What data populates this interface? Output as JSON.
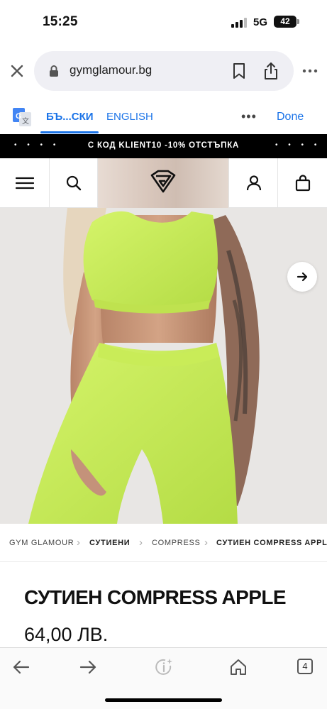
{
  "status_bar": {
    "time": "15:25",
    "network": "5G",
    "battery": "42"
  },
  "browser": {
    "url": "gymglamour.bg"
  },
  "translate": {
    "lang_active": "БЪ...СКИ",
    "lang_other": "ENGLISH",
    "more": "•••",
    "done": "Done"
  },
  "promo": {
    "dots_left": "• • • •",
    "text": "С КОД KLIENT10 -10% ОТСТЪПКА",
    "dots_right": "• • • •"
  },
  "breadcrumb": [
    {
      "label": "GYM GLAMOUR"
    },
    {
      "label": "СУТИЕНИ"
    },
    {
      "label": "COMPRESS"
    },
    {
      "label": "СУТИЕН COMPRESS APPLE"
    }
  ],
  "product": {
    "title": "СУТИЕН COMPRESS APPLE",
    "price": "64,00 ЛВ."
  },
  "toolbar": {
    "tabs_count": "4"
  },
  "colors": {
    "accent": "#1a73e8",
    "product": "#c7ee5a",
    "promo_bg": "#000000"
  }
}
